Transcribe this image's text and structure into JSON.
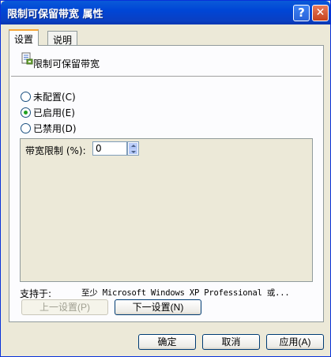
{
  "window": {
    "title": "限制可保留带宽 属性",
    "help_glyph": "?",
    "close_glyph": "✕"
  },
  "tabs": [
    {
      "label": "设置",
      "active": true
    },
    {
      "label": "说明",
      "active": false
    }
  ],
  "policy": {
    "icon": "policy-setting-icon",
    "name": "限制可保留带宽"
  },
  "radios": [
    {
      "label": "未配置(C)",
      "checked": false
    },
    {
      "label": "已启用(E)",
      "checked": true
    },
    {
      "label": "已禁用(D)",
      "checked": false
    }
  ],
  "options": {
    "bandwidth_label": "带宽限制 (%):",
    "bandwidth_value": "0"
  },
  "supported": {
    "label": "支持于:",
    "value": "至少 Microsoft Windows XP Professional 或..."
  },
  "nav": {
    "prev_label": "上一设置(P)",
    "next_label": "下一设置(N)"
  },
  "footer": {
    "ok_label": "确定",
    "cancel_label": "取消",
    "apply_label": "应用(A)"
  },
  "colors": {
    "titlebar": "#0a5ad8",
    "dialog_bg": "#ece9d8",
    "selected_radio": "#21a121",
    "tab_highlight": "#f7a636"
  }
}
